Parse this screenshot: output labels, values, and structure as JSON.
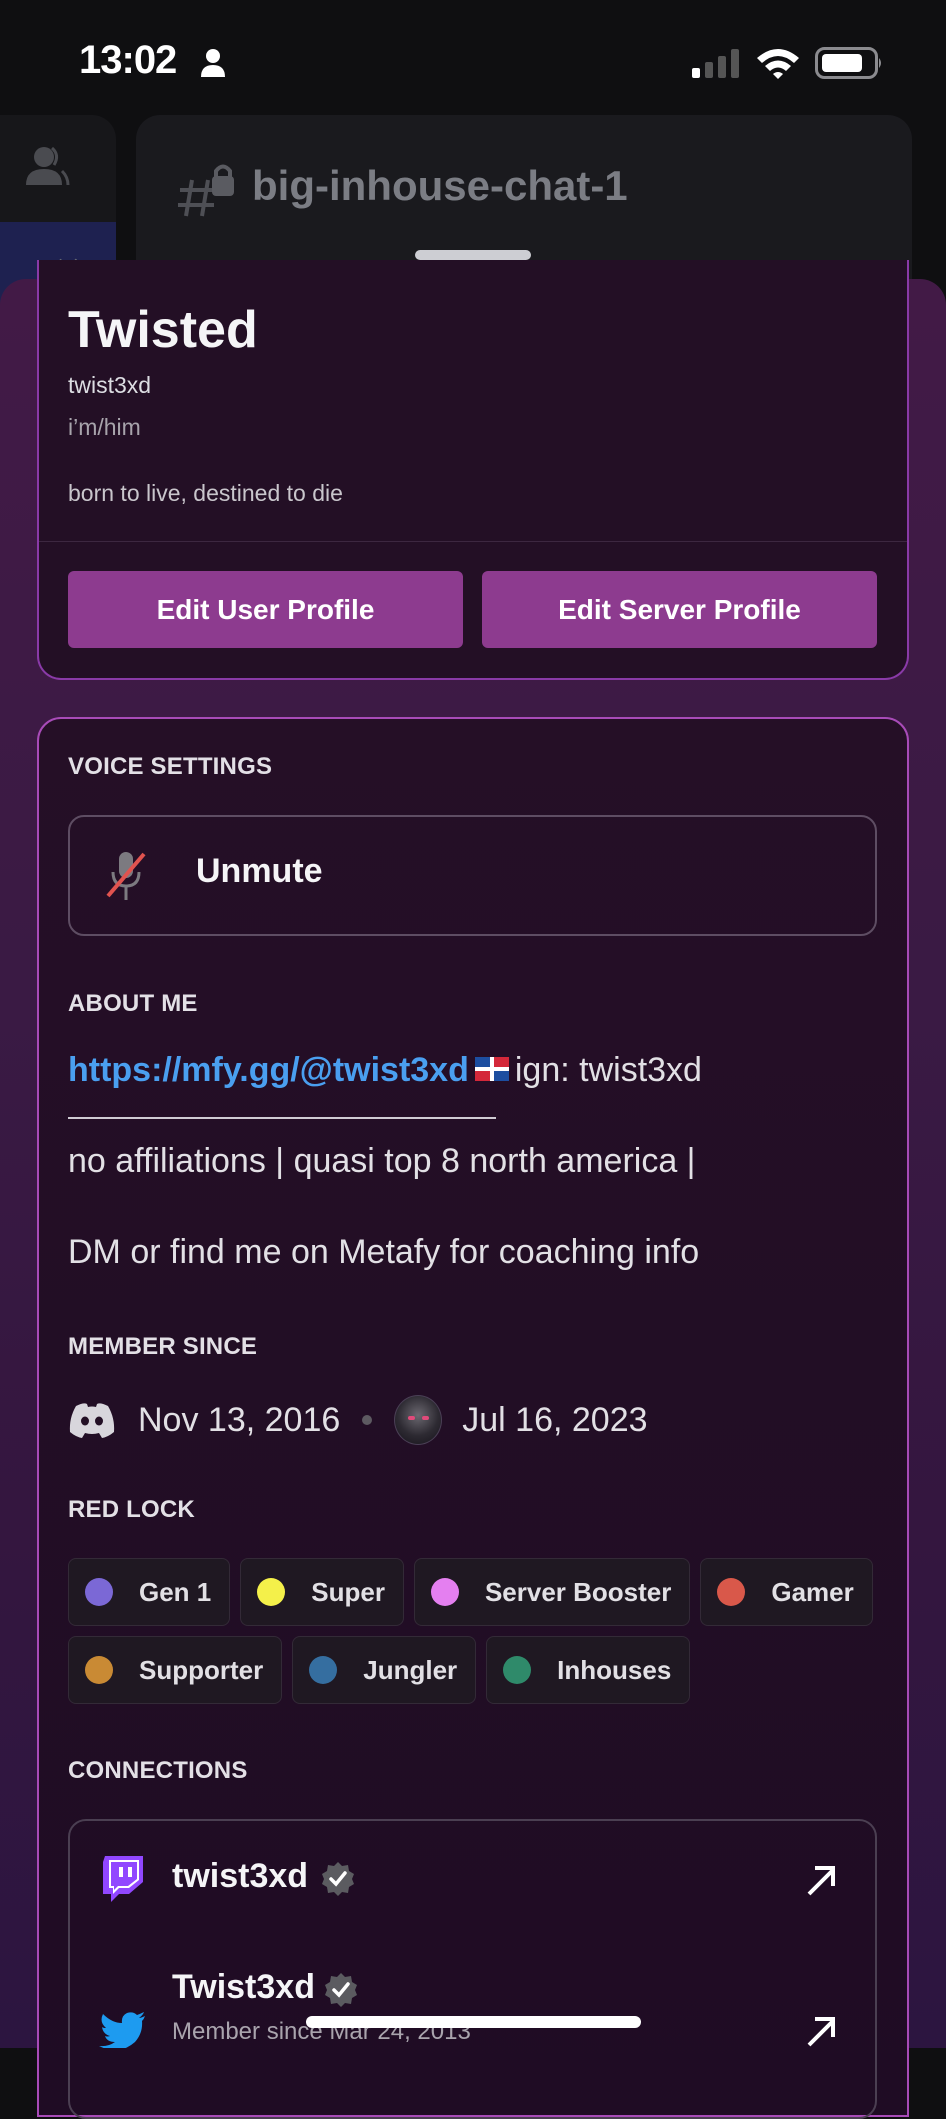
{
  "status_bar": {
    "time": "13:02",
    "icons": [
      "person-icon",
      "cellular-signal-icon",
      "wifi-icon",
      "battery-icon"
    ]
  },
  "background": {
    "channel_name": "big-inhouse-chat-1",
    "channel_icon": "locked-text-channel-icon"
  },
  "profile": {
    "display_name": "Twisted",
    "username": "twist3xd",
    "pronouns": "i’m/him",
    "bio": "born to live, destined to die",
    "buttons": {
      "edit_user_profile": "Edit User Profile",
      "edit_server_profile": "Edit Server Profile"
    }
  },
  "voice_settings": {
    "label": "VOICE SETTINGS",
    "unmute_label": "Unmute"
  },
  "about_me": {
    "label": "ABOUT ME",
    "link": "https://mfy.gg/@twist3xd",
    "after_link": "ign: twist3xd",
    "line2": "no affiliations | quasi top 8 north america |",
    "line3": "DM or find me on Metafy for coaching info"
  },
  "member_since": {
    "label": "MEMBER SINCE",
    "discord_date": "Nov 13, 2016",
    "server_date": "Jul 16, 2023"
  },
  "roles": {
    "label": "RED LOCK",
    "items": [
      {
        "name": "Gen 1",
        "color": "#7b68d6"
      },
      {
        "name": "Super",
        "color": "#f4f04a"
      },
      {
        "name": "Server Booster",
        "color": "#e47ff0"
      },
      {
        "name": "Gamer",
        "color": "#d9584a"
      },
      {
        "name": "Supporter",
        "color": "#c98a34"
      },
      {
        "name": "Jungler",
        "color": "#356ea0"
      },
      {
        "name": "Inhouses",
        "color": "#2f8a6a"
      }
    ]
  },
  "connections": {
    "label": "CONNECTIONS",
    "items": [
      {
        "platform": "twitch",
        "name": "twist3xd",
        "verified": true
      },
      {
        "platform": "twitter",
        "name": "Twist3xd",
        "verified": true,
        "subtitle": "Member since Mar 24, 2013"
      }
    ]
  },
  "colors": {
    "accent_button": "#8d3b8f",
    "link": "#4a9ff0",
    "card_border": "#a84bb8"
  }
}
